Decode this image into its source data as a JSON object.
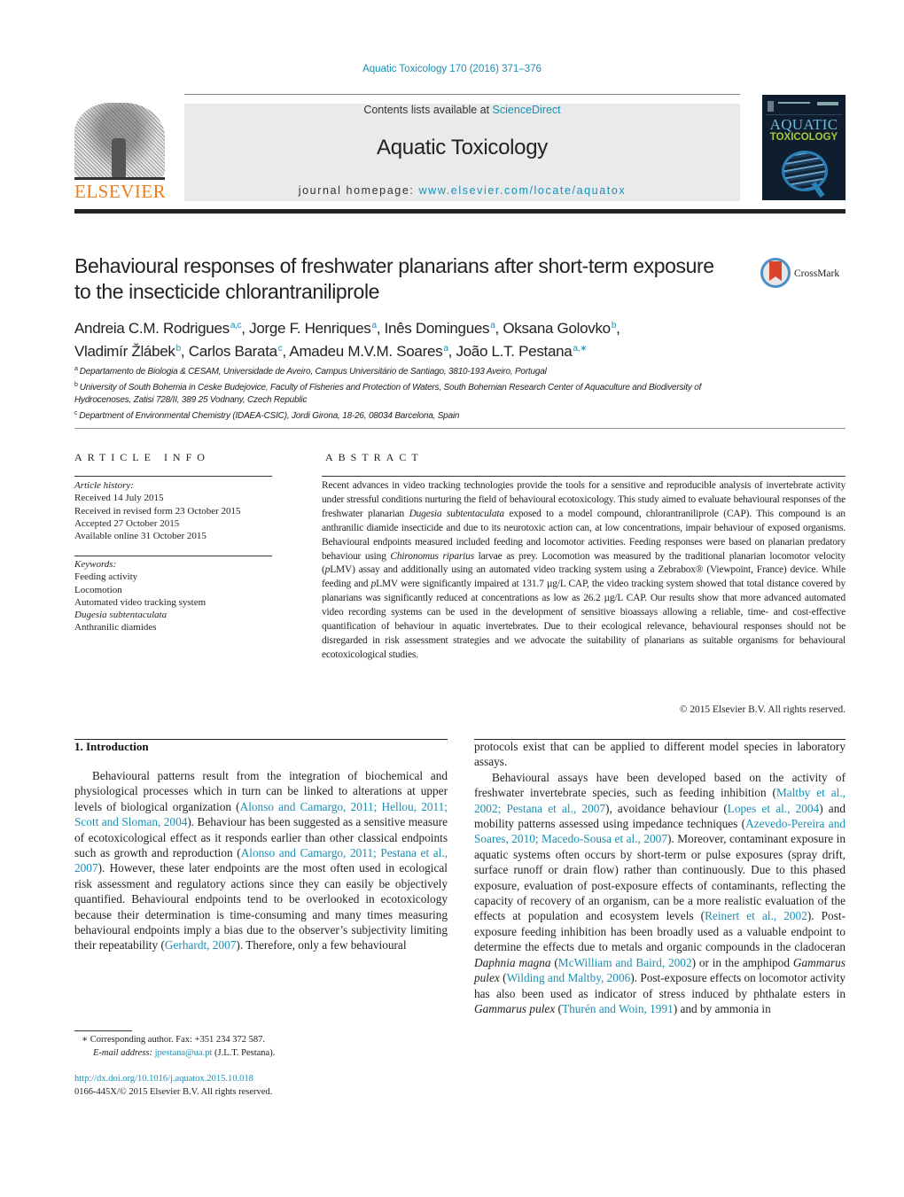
{
  "header": {
    "journal_ref": "Aquatic Toxicology 170 (2016) 371–376",
    "contents_prefix": "Contents lists available at ",
    "contents_link": "ScienceDirect",
    "journal_title": "Aquatic Toxicology",
    "homepage_prefix": "journal homepage: ",
    "homepage_link": "www.elsevier.com/locate/aquatox",
    "publisher_logo_text": "ELSEVIER",
    "cover_title_1": "AQUATIC",
    "cover_title_2": "TOXICOLOGY"
  },
  "colors": {
    "link": "#1a8fb5",
    "elsevier_orange": "#f07c1b",
    "masthead_bg": "#e9eaeb",
    "cover_bg": "#0e1e2e"
  },
  "article": {
    "title": "Behavioural responses of freshwater planarians after short-term exposure to the insecticide chlorantraniliprole",
    "crossmark_label": "CrossMark",
    "authors": [
      {
        "name": "Andreia C.M. Rodrigues",
        "sup": "a,c",
        "sep": ", "
      },
      {
        "name": "Jorge F. Henriques",
        "sup": "a",
        "sep": ", "
      },
      {
        "name": "Inês Domingues",
        "sup": "a",
        "sep": ", "
      },
      {
        "name": "Oksana Golovko",
        "sup": "b",
        "sep": ","
      },
      {
        "name": "Vladimír Žlábek",
        "sup": "b",
        "sep": ", "
      },
      {
        "name": "Carlos Barata",
        "sup": "c",
        "sep": ", "
      },
      {
        "name": "Amadeu M.V.M. Soares",
        "sup": "a",
        "sep": ", "
      },
      {
        "name": "João L.T. Pestana",
        "sup": "a,∗",
        "sep": ""
      }
    ],
    "affiliations": [
      {
        "key": "a",
        "text": "Departamento de Biologia & CESAM, Universidade de Aveiro, Campus Universitário de Santiago, 3810-193 Aveiro, Portugal"
      },
      {
        "key": "b",
        "text": "University of South Bohemia in Ceske Budejovice, Faculty of Fisheries and Protection of Waters, South Bohemian Research Center of Aquaculture and Biodiversity of Hydrocenoses, Zatisi 728/II, 389 25 Vodnany, Czech Republic"
      },
      {
        "key": "c",
        "text": "Department of Environmental Chemistry (IDAEA-CSIC), Jordi Girona, 18-26, 08034 Barcelona, Spain"
      }
    ]
  },
  "article_info": {
    "label": "ARTICLE INFO",
    "history_label": "Article history:",
    "history": [
      "Received 14 July 2015",
      "Received in revised form 23 October 2015",
      "Accepted 27 October 2015",
      "Available online 31 October 2015"
    ],
    "keywords_label": "Keywords:",
    "keywords": [
      {
        "text": "Feeding activity",
        "italic": false
      },
      {
        "text": "Locomotion",
        "italic": false
      },
      {
        "text": "Automated video tracking system",
        "italic": false
      },
      {
        "text": "Dugesia subtentaculata",
        "italic": true
      },
      {
        "text": "Anthranilic diamides",
        "italic": false
      }
    ]
  },
  "abstract": {
    "label": "ABSTRACT",
    "segments": [
      {
        "t": "Recent advances in video tracking technologies provide the tools for a sensitive and reproducible anal­ysis of invertebrate activity under stressful conditions nurturing the field of behavioural ecotoxicology. This study aimed to evaluate behavioural responses of the freshwater planarian "
      },
      {
        "t": "Dugesia subtentacu­lata",
        "i": true
      },
      {
        "t": " exposed to a model compound, chlorantraniliprole (CAP). This compound is an anthranilic diamide insecticide and due to its neurotoxic action can, at low concentrations, impair behaviour of exposed organ­isms. Behavioural endpoints measured included feeding and locomotor activities. Feeding responses were based on planarian predatory behaviour using "
      },
      {
        "t": "Chironomus riparius",
        "i": true
      },
      {
        "t": " larvae as prey. Locomotion was mea­sured by the traditional planarian locomotor velocity ("
      },
      {
        "t": "p",
        "i": true
      },
      {
        "t": "LMV) assay and additionally using an automated video tracking system using a Zebrabox® (Viewpoint, France) device. While feeding and "
      },
      {
        "t": "p",
        "i": true
      },
      {
        "t": "LMV were sig­nificantly impaired at 131.7 µg/L CAP, the video tracking system showed that total distance covered by planarians was significantly reduced at concentrations as low as 26.2 µg/L CAP. Our results show that more advanced automated video recording systems can be used in the development of sensitive bioas­says allowing a reliable, time- and cost-effective quantification of behaviour in aquatic invertebrates. Due to their ecological relevance, behavioural responses should not be disregarded in risk assessment strate­gies and we advocate the suitability of planarians as suitable organisms for behavioural ecotoxicological studies."
      }
    ],
    "copyright": "© 2015 Elsevier B.V. All rights reserved."
  },
  "introduction": {
    "heading": "1.  Introduction",
    "left_column": [
      {
        "t": "Behavioural patterns result from the integration of biochem­ical and physiological processes which in turn can be linked to alterations at upper levels of biological organization ("
      },
      {
        "t": "Alonso and Camargo, 2011; Hellou, 2011; Scott and Sloman, 2004",
        "link": true
      },
      {
        "t": "). Behaviour has been suggested as a sensitive measure of ecotoxicological effect as it responds earlier than other classical endpoints such as growth and reproduction ("
      },
      {
        "t": "Alonso and Camargo, 2011; Pestana et al., 2007",
        "link": true
      },
      {
        "t": "). However, these later endpoints are the most often used in ecological risk assessment and regulatory actions since they can easily be objectively quantified. Behavioural endpoints tend to be overlooked in ecotoxicology because their determination is time-consuming and many times measuring behavioural end­points imply a bias due to the observer’s subjectivity limiting their repeatability ("
      },
      {
        "t": "Gerhardt, 2007",
        "link": true
      },
      {
        "t": "). Therefore, only a few behavioural"
      }
    ],
    "right_column_p1": [
      {
        "t": "protocols exist that can be applied to different model species in laboratory assays."
      }
    ],
    "right_column_p2": [
      {
        "t": "Behavioural assays have been developed based on the activity of freshwater invertebrate species, such as feeding inhibition ("
      },
      {
        "t": "Maltby et al., 2002; Pestana et al., 2007",
        "link": true
      },
      {
        "t": "), avoidance behaviour ("
      },
      {
        "t": "Lopes et al., 2004",
        "link": true
      },
      {
        "t": ") and mobility patterns assessed using impedance techniques ("
      },
      {
        "t": "Azevedo-Pereira and Soares, 2010; Macedo-Sousa et al., 2007",
        "link": true
      },
      {
        "t": "). Moreover, contaminant exposure in aquatic systems often occurs by short-term or pulse exposures (spray drift, surface runoff or drain flow) rather than continuously. Due to this phased exposure, evaluation of post-exposure effects of contaminants, reflecting the capacity of recovery of an organism, can be a more realistic evalua­tion of the effects at population and ecosystem levels ("
      },
      {
        "t": "Reinert et al., 2002",
        "link": true
      },
      {
        "t": "). Post-exposure feeding inhibition has been broadly used as a valuable endpoint to determine the effects due to metals and organic compounds in the cladoceran "
      },
      {
        "t": "Daphnia magna",
        "i": true
      },
      {
        "t": " ("
      },
      {
        "t": "McWilliam and Baird, 2002",
        "link": true
      },
      {
        "t": ") or in the amphipod "
      },
      {
        "t": "Gammarus pulex",
        "i": true
      },
      {
        "t": " ("
      },
      {
        "t": "Wilding and Maltby, 2006",
        "link": true
      },
      {
        "t": "). Post-exposure effects on locomotor activity has also been used as indicator of stress induced by phthalate esters in "
      },
      {
        "t": "Gammarus pulex",
        "i": true
      },
      {
        "t": " ("
      },
      {
        "t": "Thurén and Woin, 1991",
        "link": true
      },
      {
        "t": ") and by ammonia in"
      }
    ]
  },
  "footnotes": {
    "corresponding": "∗  Corresponding author. Fax: +351 234 372 587.",
    "email_label": "E-mail address: ",
    "email": "jpestana@ua.pt",
    "email_suffix": " (J.L.T. Pestana).",
    "doi": "http://dx.doi.org/10.1016/j.aquatox.2015.10.018",
    "issn": "0166-445X/© 2015 Elsevier B.V. All rights reserved."
  }
}
